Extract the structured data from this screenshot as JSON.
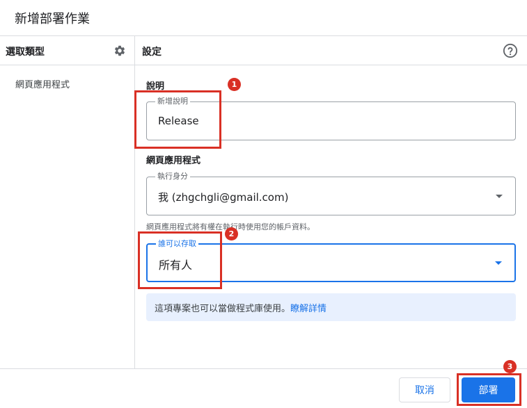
{
  "dialog": {
    "title": "新增部署作業"
  },
  "left_panel": {
    "header": "選取類型",
    "settings_icon": "gear-icon",
    "items": [
      {
        "label": "網頁應用程式"
      }
    ]
  },
  "right_panel": {
    "header": "設定",
    "help_icon": "help-circle-icon",
    "description_section": {
      "label": "說明",
      "field_legend": "新增說明",
      "field_value": "Release"
    },
    "webapp_section": {
      "label": "網頁應用程式",
      "execute_as": {
        "legend": "執行身分",
        "value": "我 (zhgchgli@gmail.com)",
        "hint": "網頁應用程式將有權在執行時使用您的帳戶資料。"
      },
      "access": {
        "legend": "誰可以存取",
        "value": "所有人"
      }
    },
    "info_banner": {
      "text": "這項專案也可以當做程式庫使用。",
      "link": "瞭解詳情"
    }
  },
  "footer": {
    "cancel_label": "取消",
    "deploy_label": "部署"
  },
  "annotations": {
    "color": "#d93025",
    "badges": [
      "1",
      "2",
      "3"
    ]
  },
  "colors": {
    "accent": "#1a73e8",
    "info_background": "#e8f0fe",
    "annotation": "#d93025"
  }
}
